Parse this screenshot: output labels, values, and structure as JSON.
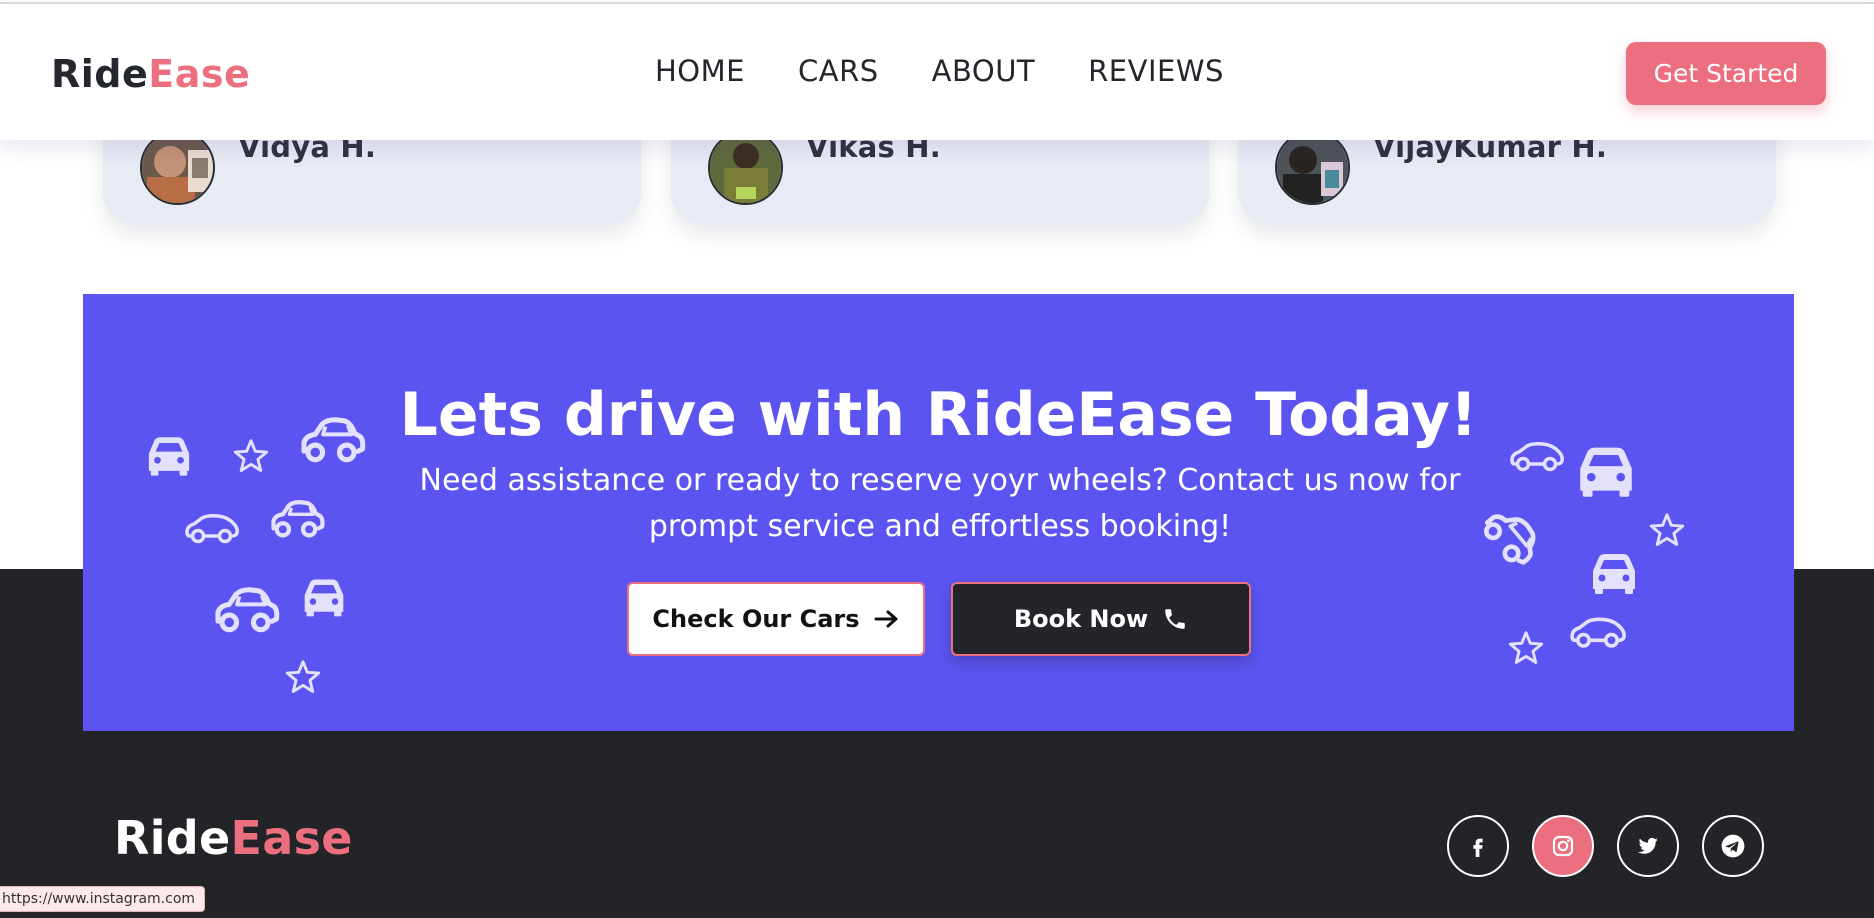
{
  "header": {
    "logo_part1": "Ride",
    "logo_part2": "Ease",
    "nav": [
      "HOME",
      "CARS",
      "ABOUT",
      "REVIEWS"
    ],
    "cta_label": "Get Started"
  },
  "reviews": [
    {
      "name": "Vidya H."
    },
    {
      "name": "Vikas H."
    },
    {
      "name": "VijayKumar H."
    }
  ],
  "banner": {
    "title": "Lets drive with RideEase Today!",
    "subtitle": "Need assistance or ready to reserve yoyr wheels? Contact us now for prompt service and effortless booking!",
    "check_cars_label": "Check Our Cars",
    "book_now_label": "Book Now"
  },
  "footer": {
    "logo_part1": "Ride",
    "logo_part2": "Ease",
    "social_icons": [
      "facebook-icon",
      "instagram-icon",
      "twitter-icon",
      "telegram-icon"
    ]
  },
  "status_bar": {
    "url": "https://www.instagram.com"
  },
  "colors": {
    "brand_pink": "#ec6f80",
    "banner_purple": "#5b54f0",
    "footer_dark": "#222428",
    "card_bg": "#e7ebf4"
  }
}
